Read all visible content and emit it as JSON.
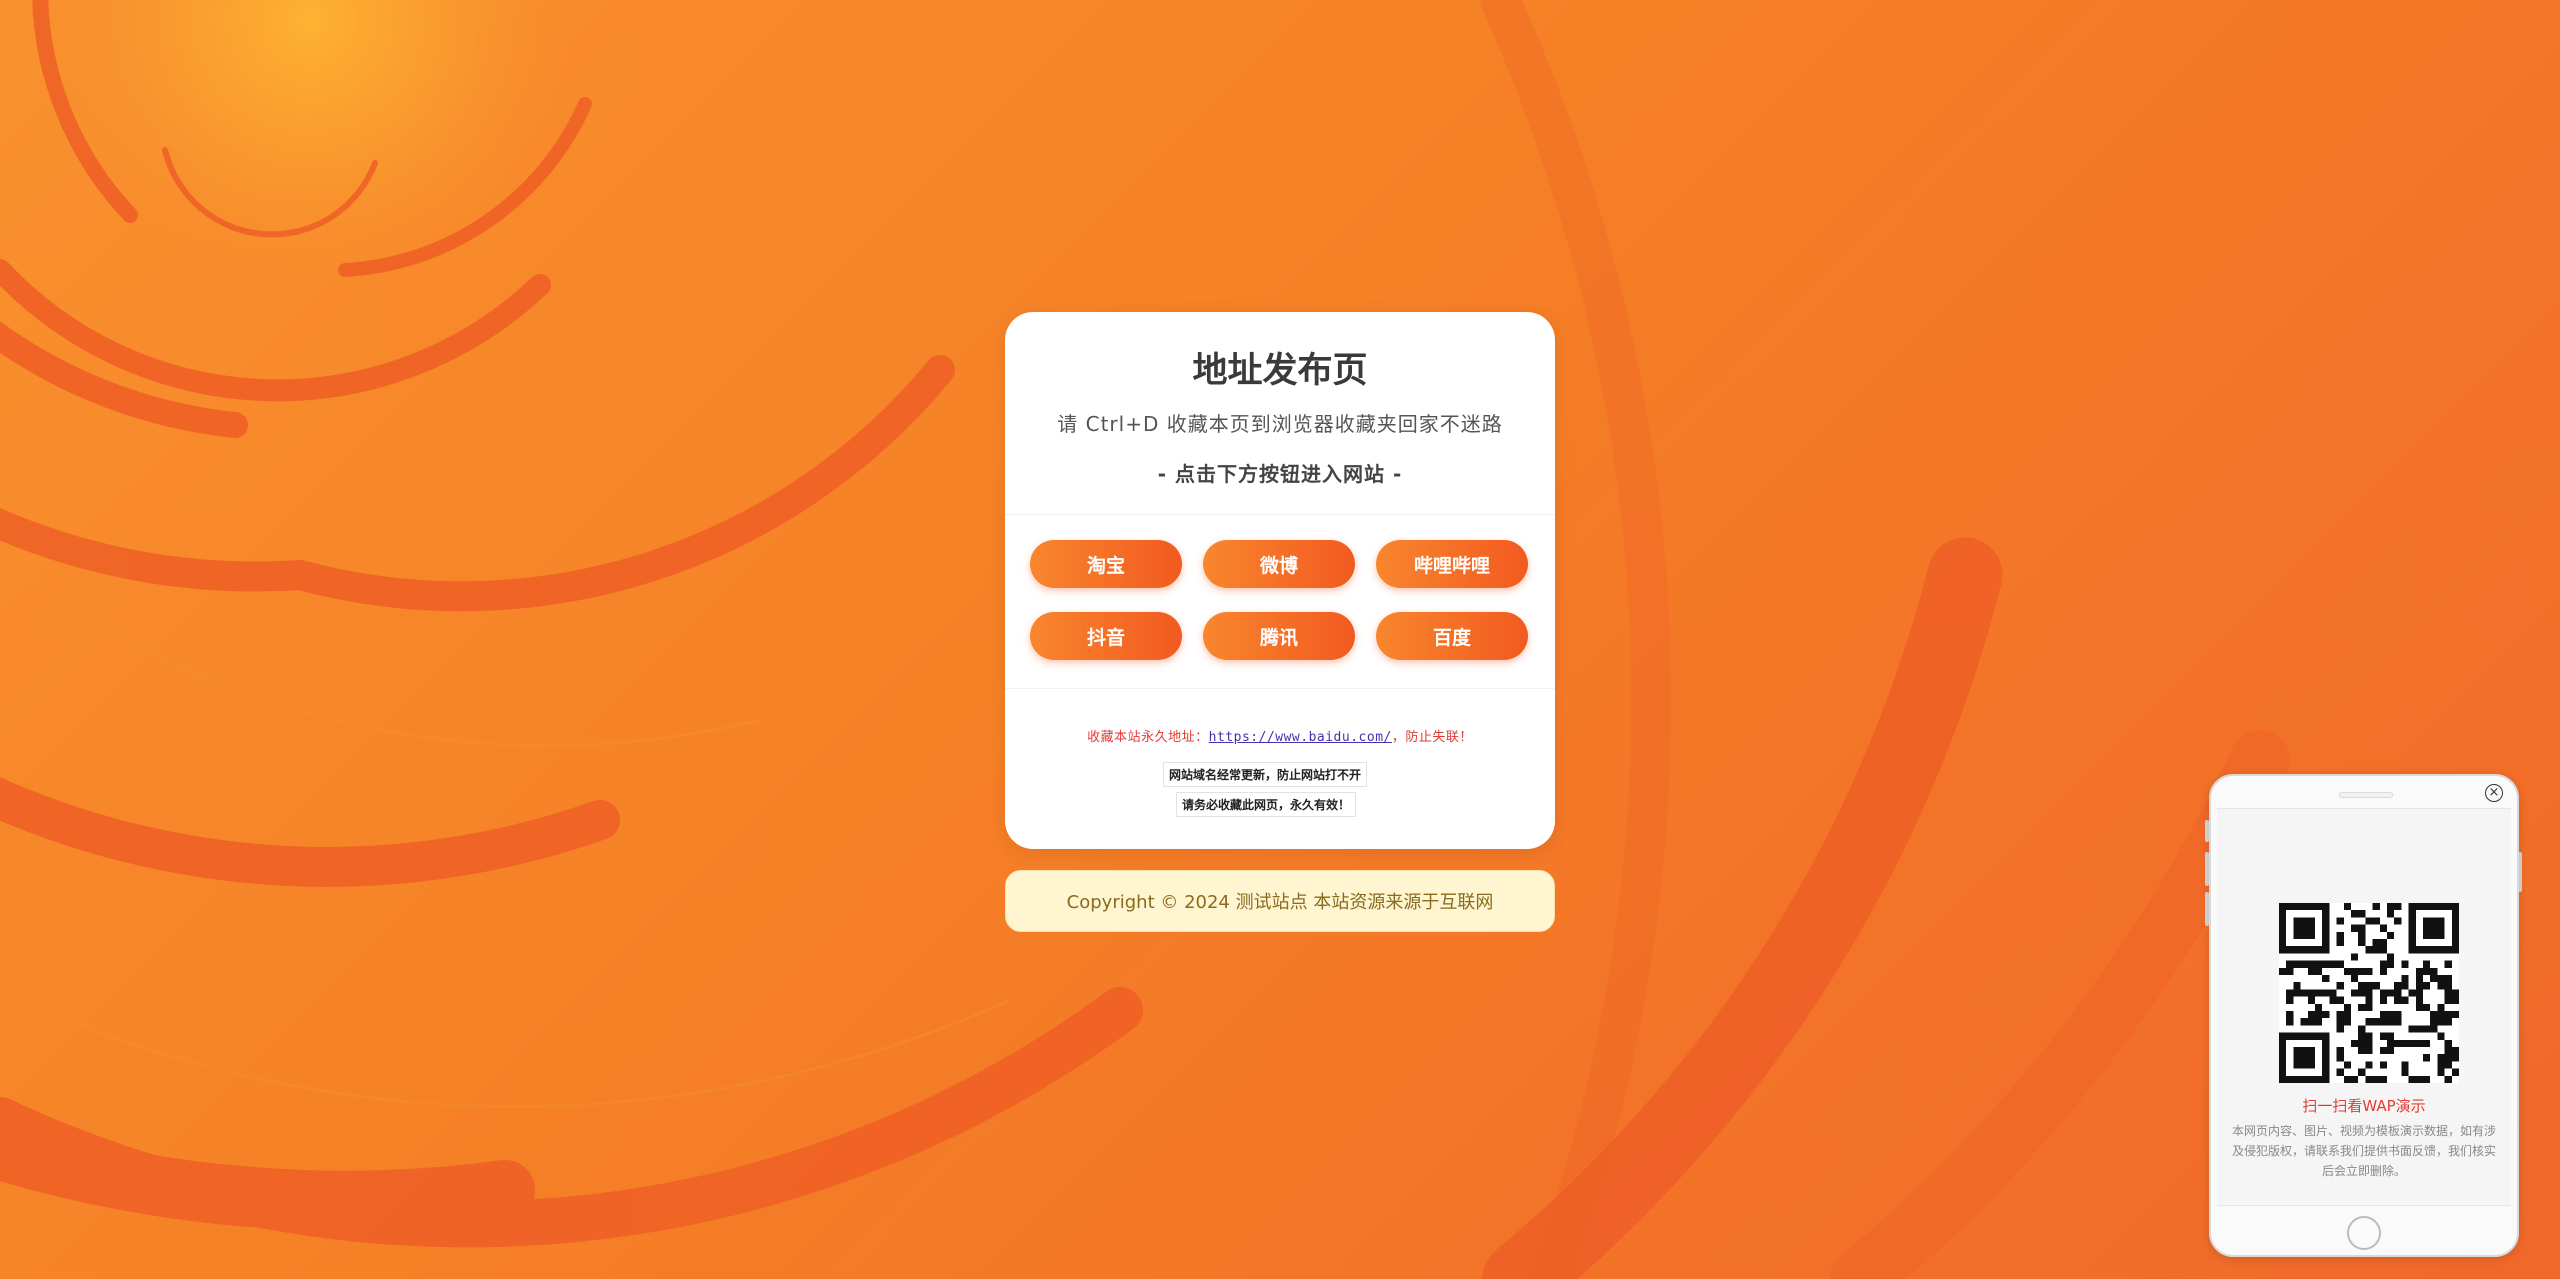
{
  "page": {
    "title": "地址发布页",
    "subtitle": "请 Ctrl+D 收藏本页到浏览器收藏夹回家不迷路",
    "enter_hint": "- 点击下方按钮进入网站 -"
  },
  "buttons": [
    {
      "label": "淘宝"
    },
    {
      "label": "微博"
    },
    {
      "label": "哔哩哔哩"
    },
    {
      "label": "抖音"
    },
    {
      "label": "腾讯"
    },
    {
      "label": "百度"
    }
  ],
  "notice": {
    "prefix": "收藏本站永久地址：",
    "url": "https://www.baidu.com/",
    "suffix": "，防止失联！",
    "tag1": "网站域名经常更新，防止网站打不开",
    "tag2": "请务必收藏此网页，永久有效！"
  },
  "footer": {
    "text": "Copyright © 2024 测试站点 本站资源来源于互联网"
  },
  "phone": {
    "close_icon": "×",
    "qr_label": "扫一扫看WAP演示",
    "disclaimer": "本网页内容、图片、视频为模板演示数据，如有涉及侵犯版权，请联系我们提供书面反馈，我们核实后会立即删除。"
  },
  "colors": {
    "background_start": "#f9912e",
    "background_end": "#f1682a",
    "button_start": "#f8862e",
    "button_end": "#f25a1f",
    "notice_red": "#e53935",
    "footer_bg": "#fff5d0"
  }
}
